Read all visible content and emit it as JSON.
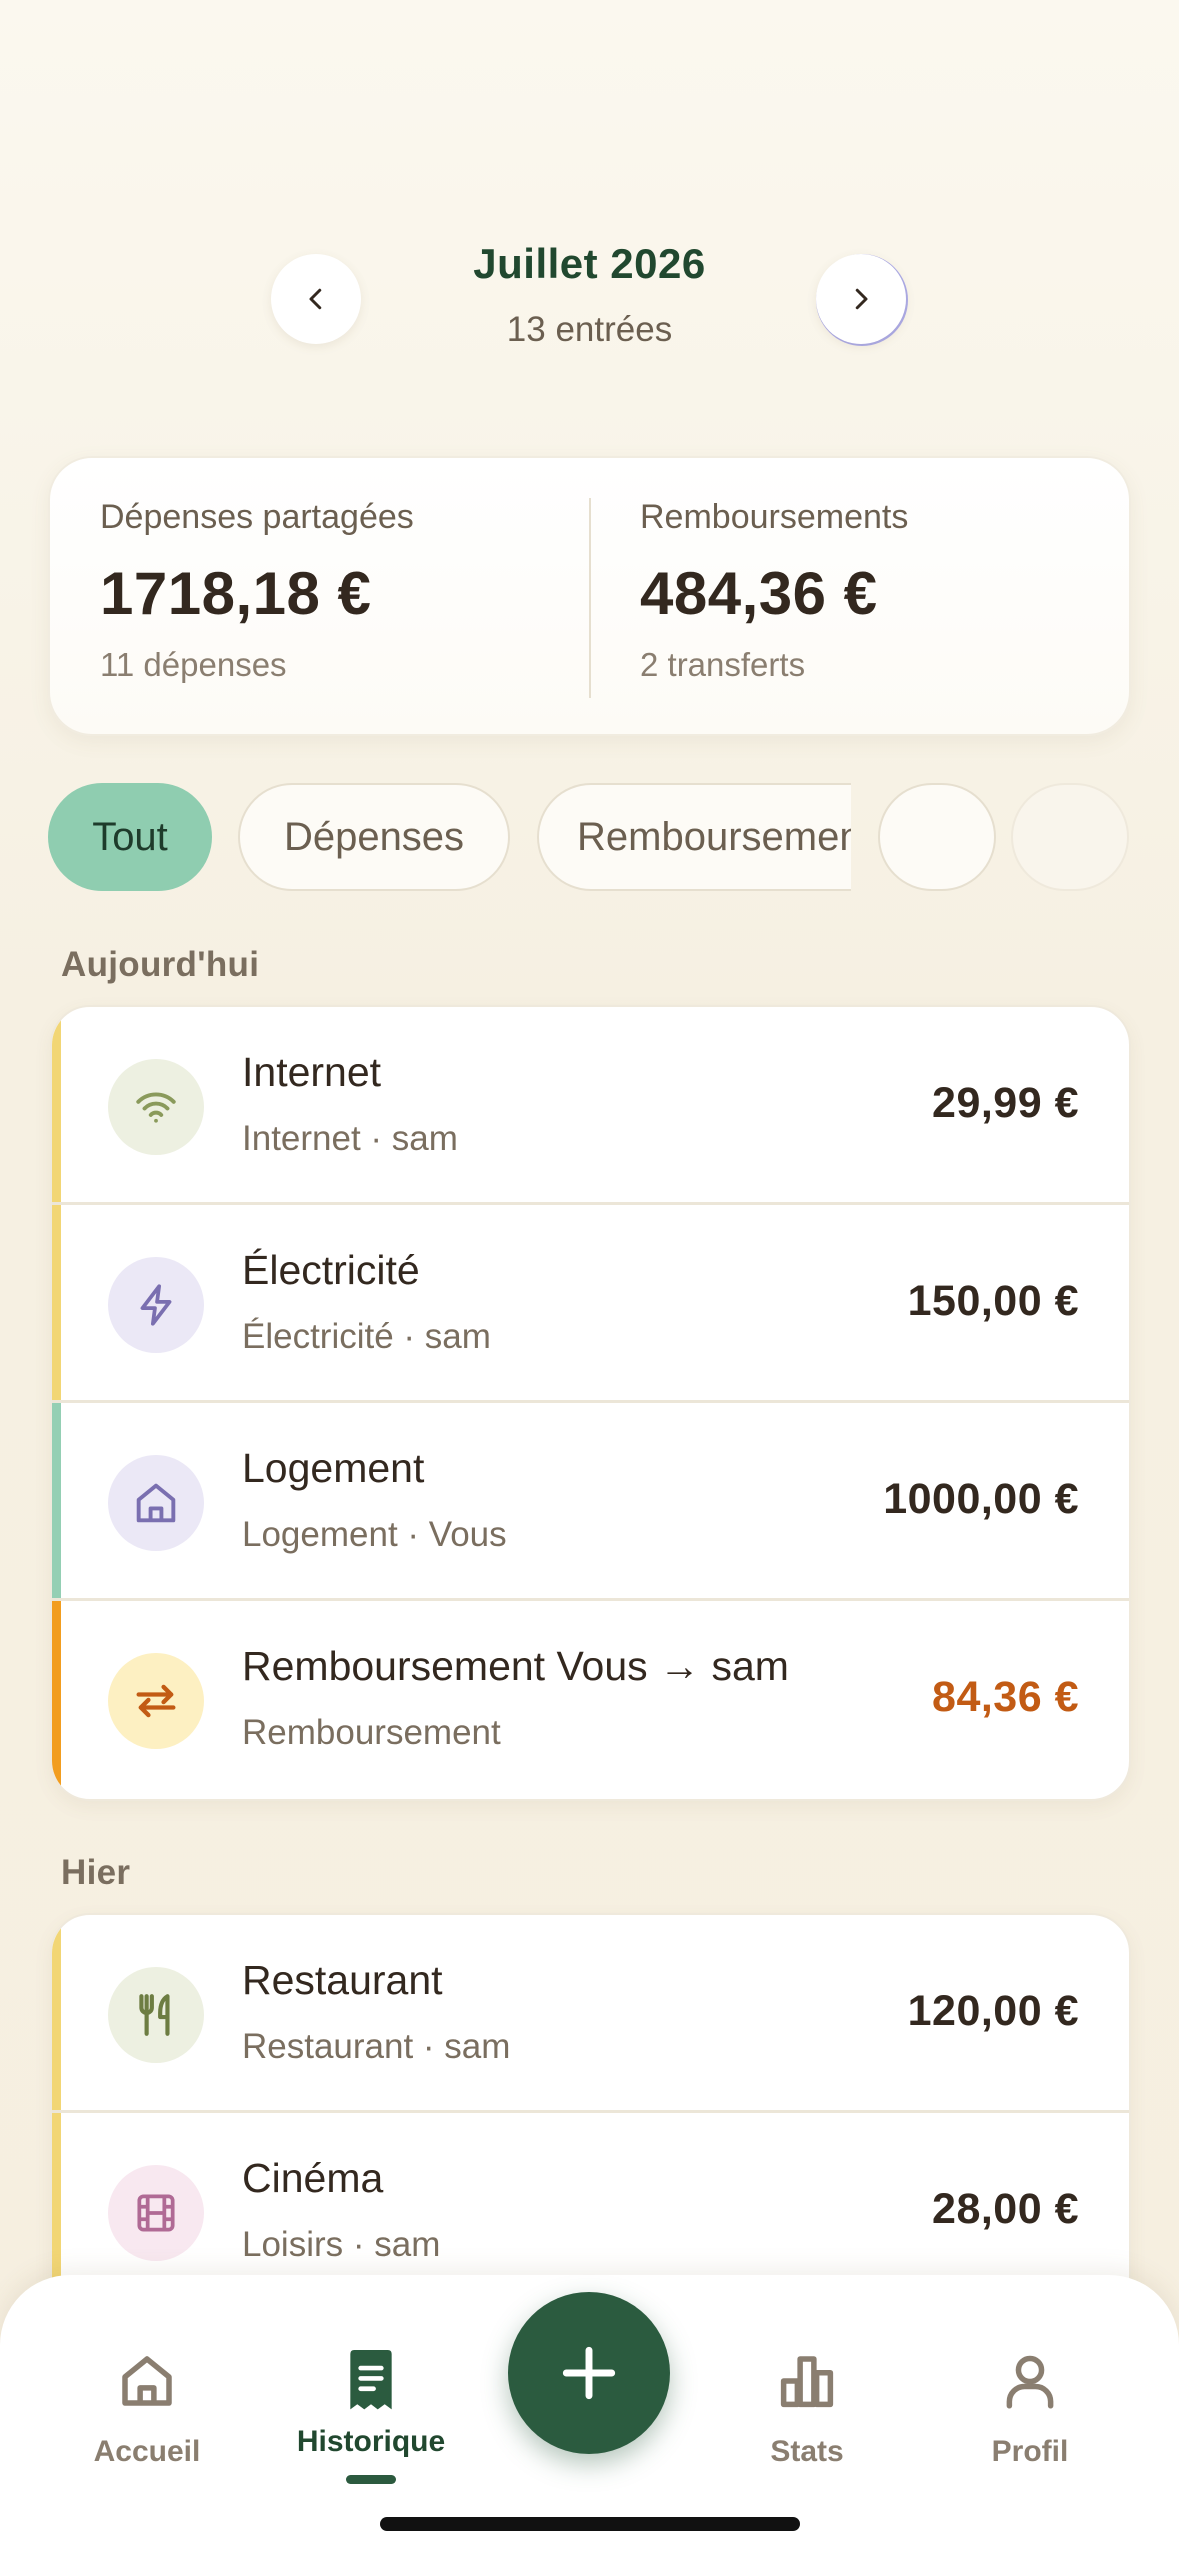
{
  "header": {
    "month": "Juillet 2026",
    "entries": "13 entrées"
  },
  "summary": {
    "expenses": {
      "label": "Dépenses partagées",
      "value": "1718,18 €",
      "meta": "11 dépenses"
    },
    "repayments": {
      "label": "Remboursements",
      "value": "484,36 €",
      "meta": "2 transferts"
    }
  },
  "filters": [
    "Tout",
    "Dépenses",
    "Remboursements"
  ],
  "sections": {
    "today": {
      "title": "Aujourd'hui",
      "items": [
        {
          "title": "Internet",
          "subtitle": "Internet · sam",
          "amount": "29,99 €",
          "icon": "wifi-icon"
        },
        {
          "title": "Électricité",
          "subtitle": "Électricité · sam",
          "amount": "150,00 €",
          "icon": "lightning-icon"
        },
        {
          "title": "Logement",
          "subtitle": "Logement · Vous",
          "amount": "1000,00 €",
          "icon": "house-icon"
        },
        {
          "title": "Remboursement Vous → sam",
          "subtitle": "Remboursement",
          "amount": "84,36 €",
          "icon": "transfer-icon"
        }
      ]
    },
    "yesterday": {
      "title": "Hier",
      "items": [
        {
          "title": "Restaurant",
          "subtitle": "Restaurant · sam",
          "amount": "120,00 €",
          "icon": "fork-knife-icon"
        },
        {
          "title": "Cinéma",
          "subtitle": "Loisirs · sam",
          "amount": "28,00 €",
          "icon": "film-icon"
        }
      ]
    }
  },
  "tabbar": {
    "home": "Accueil",
    "history": "Historique",
    "stats": "Stats",
    "profile": "Profil"
  },
  "colors": {
    "accent": "#2b5b3f",
    "active_chip": "#8fcdb0",
    "stripe_yellow": "#f2d675",
    "stripe_green": "#94cfb4",
    "stripe_orange": "#f29d1f",
    "repayment_amount": "#c25b14"
  }
}
